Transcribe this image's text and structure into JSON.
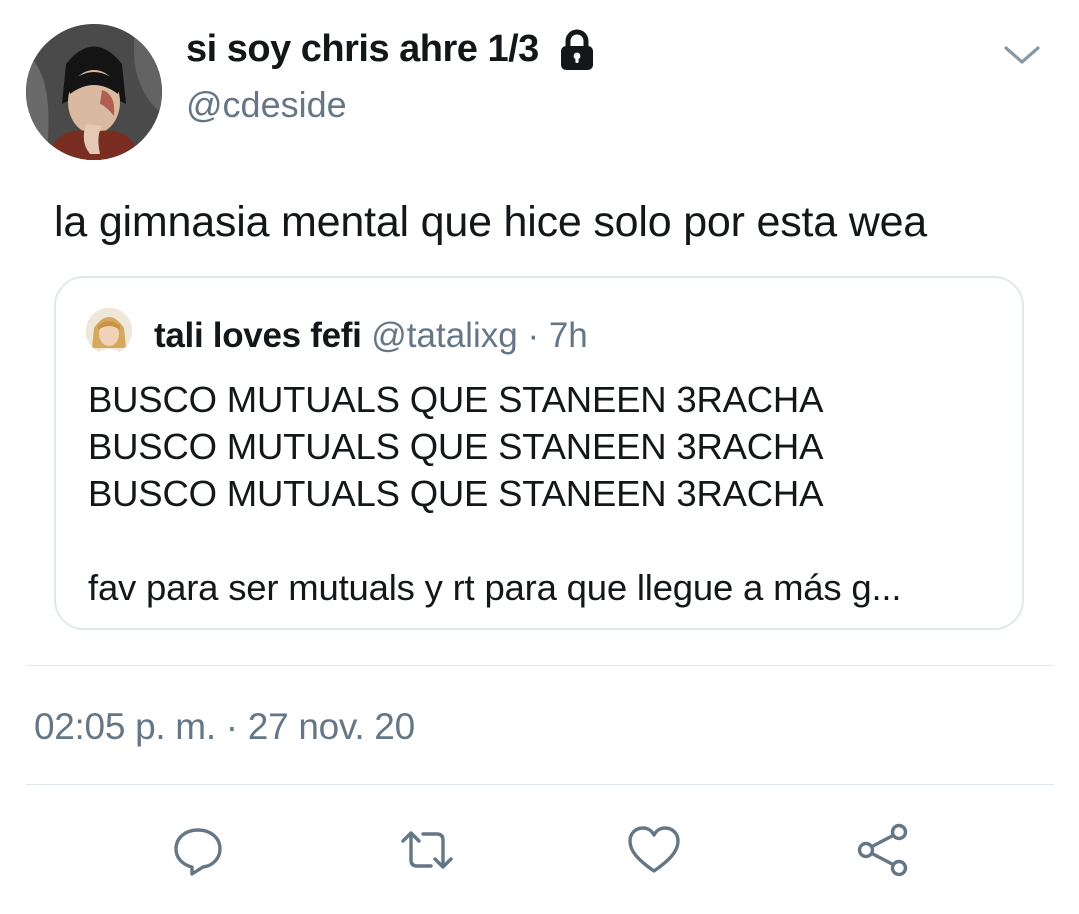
{
  "author": {
    "display_name": "si soy chris ahre 1/3",
    "handle": "@cdeside",
    "avatar_icon": "avatar-image",
    "lock_icon": "lock-icon"
  },
  "tweet": {
    "text": "la gimnasia mental que hice solo por esta wea",
    "timestamp": "02:05 p. m. · 27 nov. 20"
  },
  "quoted_tweet": {
    "name": "tali loves fefi",
    "handle": "@tatalixg",
    "separator": "·",
    "time": "7h",
    "text": "BUSCO MUTUALS QUE STANEEN 3RACHA\nBUSCO MUTUALS QUE STANEEN 3RACHA\nBUSCO MUTUALS QUE STANEEN 3RACHA\n\nfav para ser mutuals y rt para que llegue a más g..."
  },
  "actions": [
    {
      "name": "reply",
      "icon": "reply-icon"
    },
    {
      "name": "retweet",
      "icon": "retweet-icon"
    },
    {
      "name": "like",
      "icon": "heart-icon"
    },
    {
      "name": "share",
      "icon": "share-icon"
    }
  ],
  "colors": {
    "text": "#14171a",
    "secondary": "#657786",
    "border": "#e1e8ed"
  }
}
